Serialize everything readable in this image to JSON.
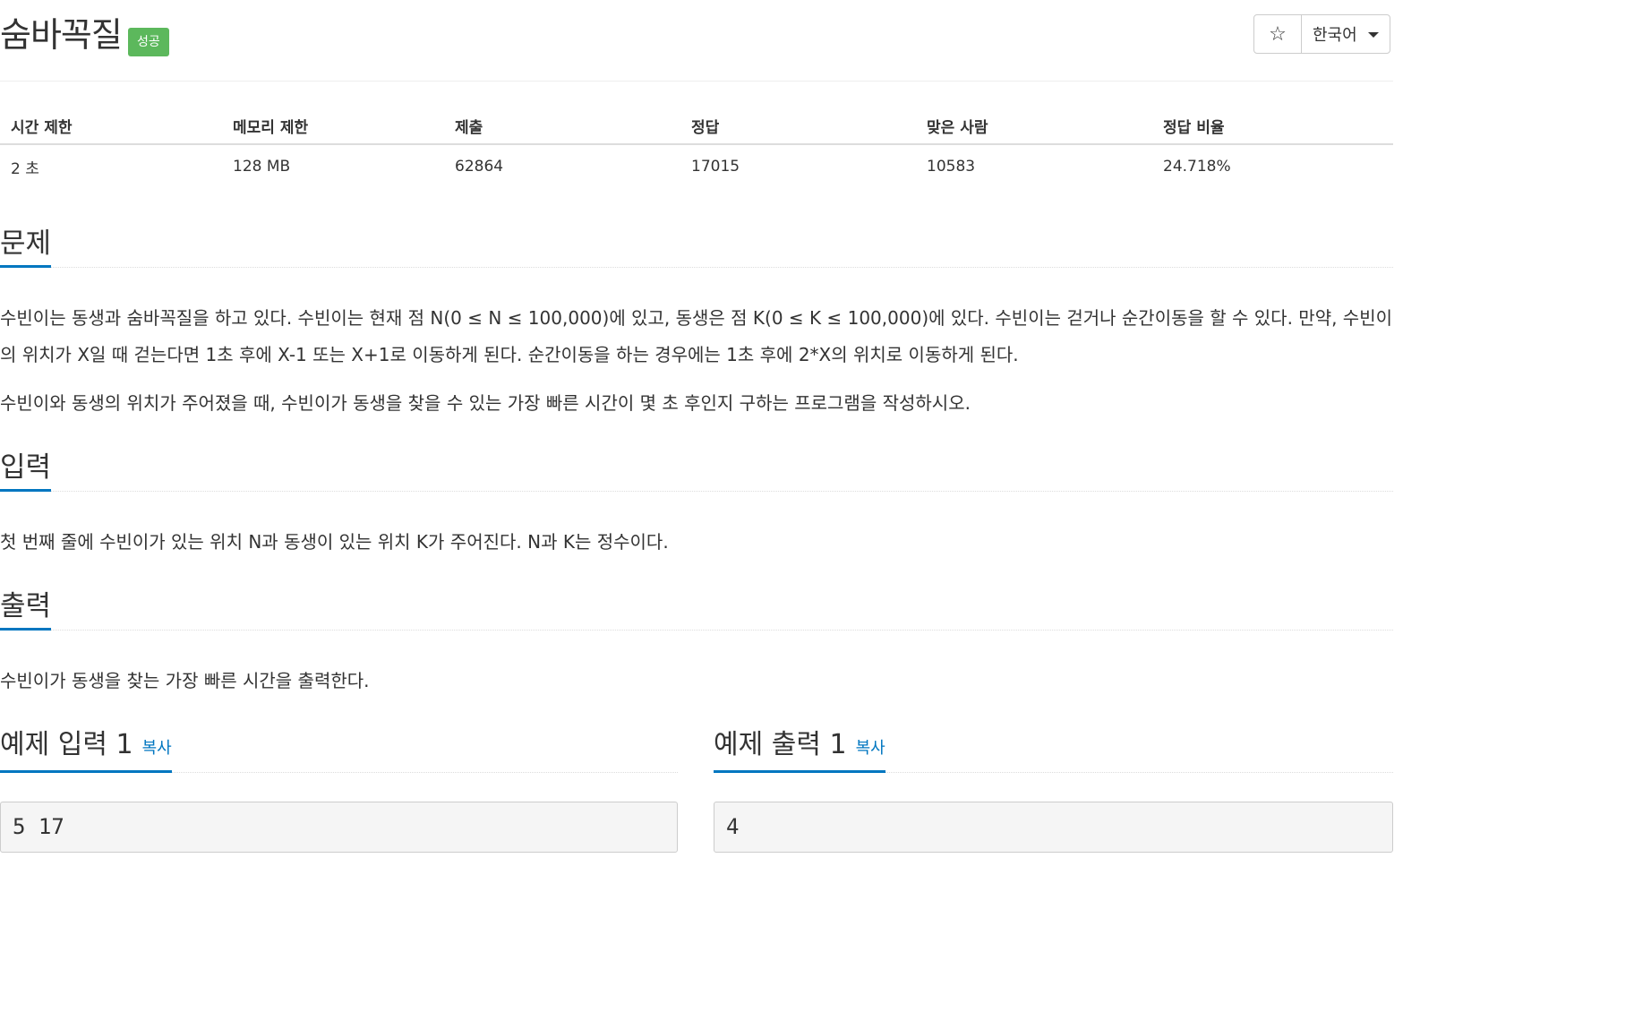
{
  "problem": {
    "title": "숨바꼭질",
    "badge": "성공"
  },
  "actions": {
    "star_icon": "star-icon",
    "star_glyph": "☆",
    "language": "한국어"
  },
  "info": {
    "headers": [
      "시간 제한",
      "메모리 제한",
      "제출",
      "정답",
      "맞은 사람",
      "정답 비율"
    ],
    "values": [
      "2 초",
      "128 MB",
      "62864",
      "17015",
      "10583",
      "24.718%"
    ]
  },
  "sections": {
    "problem_heading": "문제",
    "problem_p1": "수빈이는 동생과 숨바꼭질을 하고 있다. 수빈이는 현재 점 N(0 ≤ N ≤ 100,000)에 있고, 동생은 점 K(0 ≤ K ≤ 100,000)에 있다. 수빈이는 걷거나 순간이동을 할 수 있다. 만약, 수빈이의 위치가 X일 때 걷는다면 1초 후에 X-1 또는 X+1로 이동하게 된다. 순간이동을 하는 경우에는 1초 후에 2*X의 위치로 이동하게 된다.",
    "problem_p2": "수빈이와 동생의 위치가 주어졌을 때, 수빈이가 동생을 찾을 수 있는 가장 빠른 시간이 몇 초 후인지 구하는 프로그램을 작성하시오.",
    "input_heading": "입력",
    "input_text": "첫 번째 줄에 수빈이가 있는 위치 N과 동생이 있는 위치 K가 주어진다. N과 K는 정수이다.",
    "output_heading": "출력",
    "output_text": "수빈이가 동생을 찾는 가장 빠른 시간을 출력한다."
  },
  "samples": {
    "input_heading": "예제 입력 1",
    "input_copy": "복사",
    "input_value": "5 17",
    "output_heading": "예제 출력 1",
    "output_copy": "복사",
    "output_value": "4"
  },
  "colors": {
    "accent": "#0076c0",
    "badge": "#5cb85c"
  }
}
